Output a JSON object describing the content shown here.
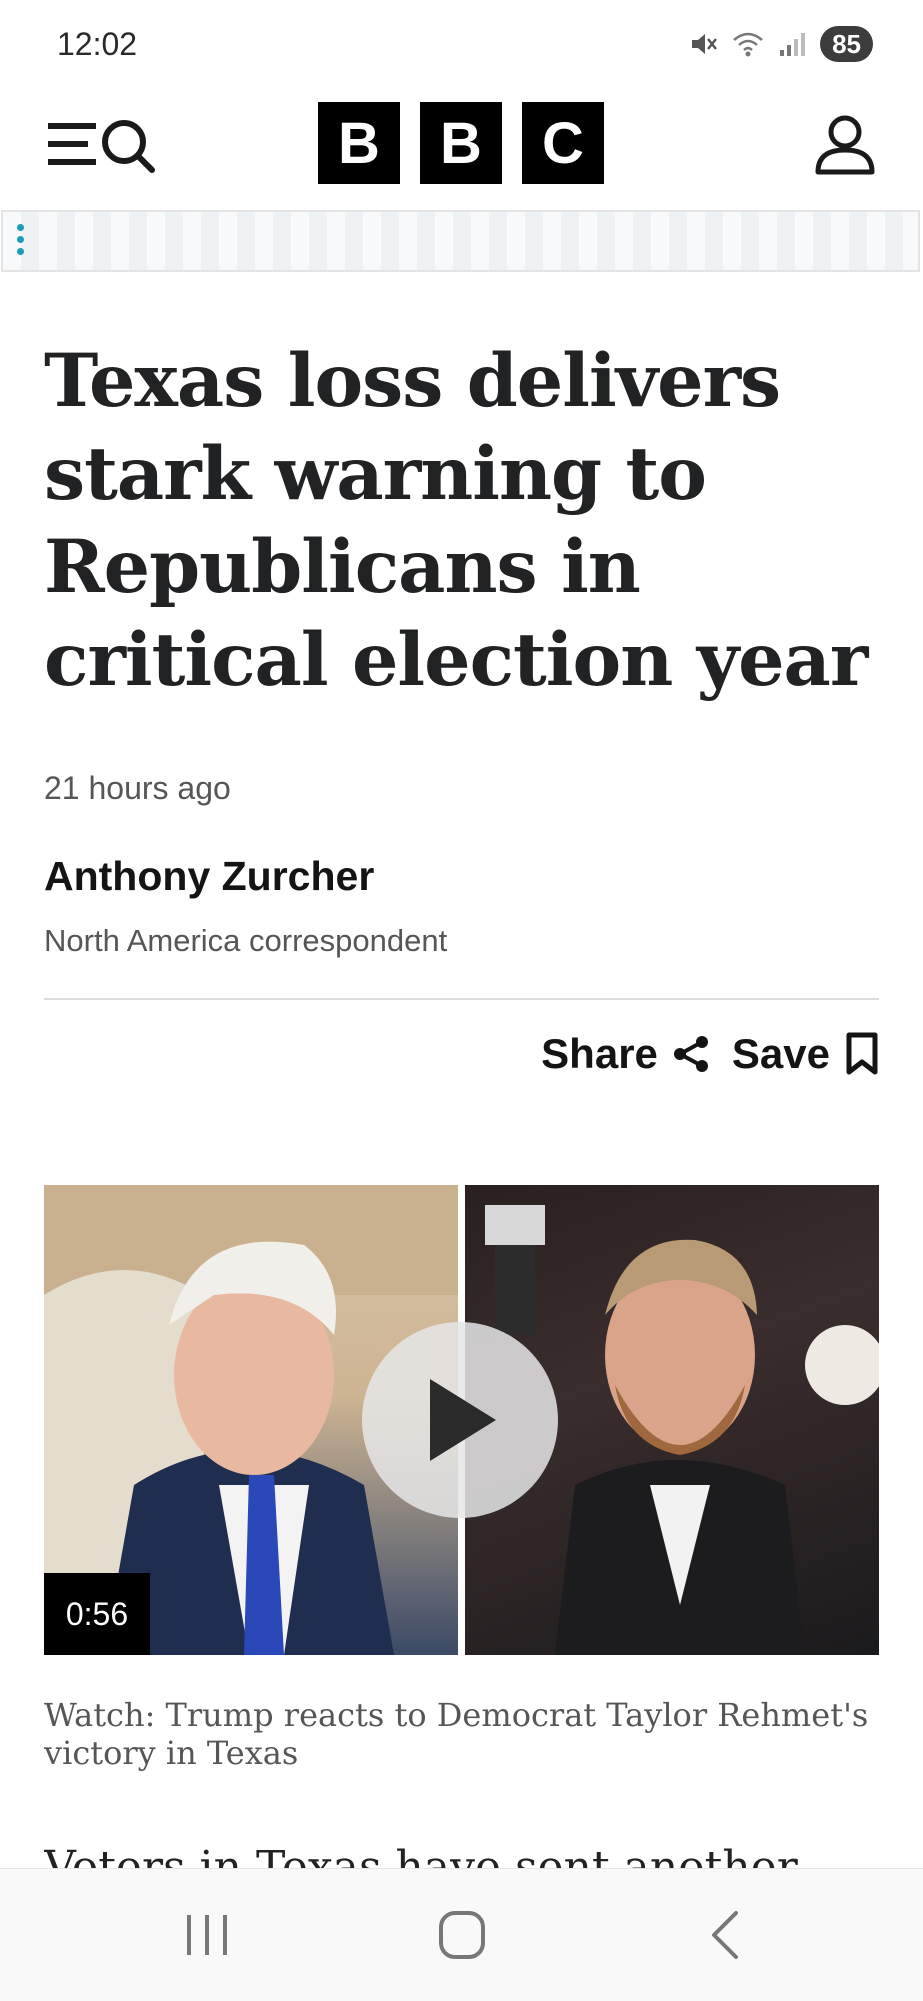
{
  "status_bar": {
    "time": "12:02",
    "battery": "85",
    "icons": [
      "mute-icon",
      "wifi-icon",
      "signal-icon",
      "battery-icon"
    ]
  },
  "nav": {
    "menu_icon": "menu-icon",
    "search_icon": "search-icon",
    "logo_letters": [
      "B",
      "B",
      "C"
    ],
    "account_icon": "user-icon"
  },
  "article": {
    "headline": "Texas loss delivers stark warning to Republicans in critical election year",
    "timestamp": "21 hours ago",
    "author": "Anthony Zurcher",
    "author_role": "North America correspondent",
    "share_label": "Share",
    "save_label": "Save",
    "video": {
      "duration": "0:56",
      "caption": "Watch: Trump reacts to Democrat Taylor Rehmet's victory in Texas"
    },
    "body_peek": "Voters in Texas have sent another"
  },
  "colors": {
    "text": "#202224",
    "muted": "#545658",
    "logo_bg": "#000000",
    "ad_accent": "#1a9bb8"
  }
}
